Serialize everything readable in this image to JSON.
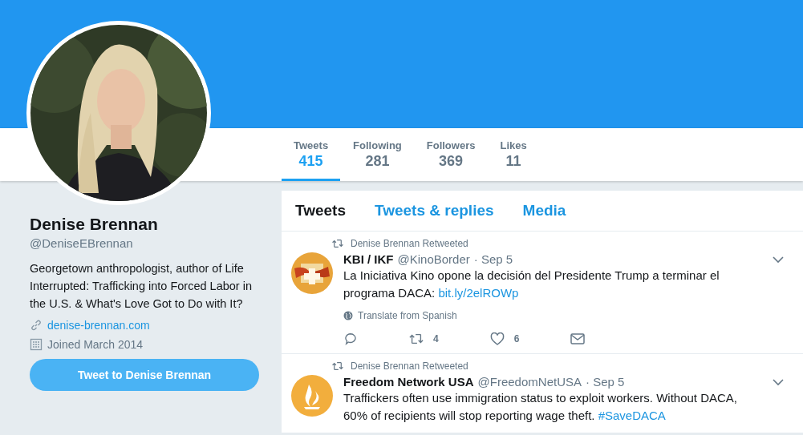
{
  "profile": {
    "name": "Denise Brennan",
    "handle": "@DeniseEBrennan",
    "bio": "Georgetown anthropologist, author of Life Interrupted: Trafficking into Forced Labor in the U.S. & What's Love Got to Do with It?",
    "website": "denise-brennan.com",
    "joined": "Joined March 2014",
    "tweet_button": "Tweet to Denise Brennan"
  },
  "stats": [
    {
      "label": "Tweets",
      "value": "415",
      "selected": true
    },
    {
      "label": "Following",
      "value": "281",
      "selected": false
    },
    {
      "label": "Followers",
      "value": "369",
      "selected": false
    },
    {
      "label": "Likes",
      "value": "11",
      "selected": false
    }
  ],
  "timeline_tabs": [
    {
      "label": "Tweets",
      "selected": true
    },
    {
      "label": "Tweets & replies",
      "selected": false
    },
    {
      "label": "Media",
      "selected": false
    }
  ],
  "tweets": [
    {
      "context": "Denise Brennan Retweeted",
      "kind": "hands",
      "name": "KBI / IKF",
      "handle": "@KinoBorder",
      "date": "· Sep 5",
      "text": "La Iniciativa Kino opone la decisión del Presidente Trump a terminar el programa DACA:",
      "link": "bit.ly/2elROWp",
      "translate": "Translate from Spanish",
      "actions": {
        "retweets": "4",
        "likes": "6"
      }
    },
    {
      "context": "Denise Brennan Retweeted",
      "kind": "flame",
      "name": "Freedom Network USA",
      "handle": "@FreedomNetUSA",
      "date": "· Sep 5",
      "text": "Traffickers often use immigration status to exploit workers. Without DACA, 60% of recipients will stop reporting wage theft.",
      "link": "#SaveDACA"
    }
  ]
}
